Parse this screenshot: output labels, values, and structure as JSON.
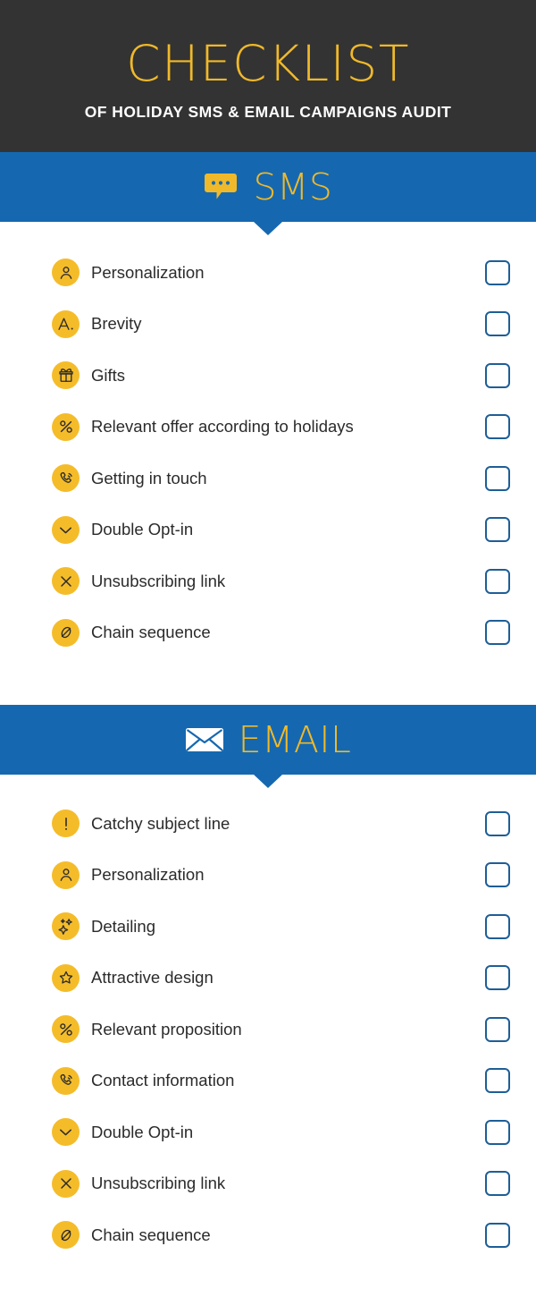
{
  "header": {
    "title": "CHECKLIST",
    "subtitle": "OF HOLIDAY SMS & EMAIL CAMPAIGNS AUDIT"
  },
  "colors": {
    "header_bg": "#333333",
    "banner_bg": "#1568B0",
    "gold": "#F0B92A",
    "bullet_gold": "#F5BC2A",
    "text_dark": "#2B2B2B",
    "checkbox_border": "#1E5E96",
    "page_bg": "#FFFFFF"
  },
  "sections": [
    {
      "id": "sms",
      "label": "SMS",
      "icon": "speech-bubble-icon",
      "items": [
        {
          "label": "Personalization",
          "icon": "person-icon",
          "checked": false
        },
        {
          "label": "Brevity",
          "icon": "letter-a-icon",
          "checked": false
        },
        {
          "label": "Gifts",
          "icon": "gift-box-icon",
          "checked": false
        },
        {
          "label": "Relevant offer according to holidays",
          "icon": "percent-icon",
          "checked": false
        },
        {
          "label": "Getting in touch",
          "icon": "phone-call-icon",
          "checked": false
        },
        {
          "label": "Double Opt-in",
          "icon": "chevron-down-icon",
          "checked": false
        },
        {
          "label": "Unsubscribing link",
          "icon": "close-x-icon",
          "checked": false
        },
        {
          "label": "Chain sequence",
          "icon": "slashed-circle-icon",
          "checked": false
        }
      ]
    },
    {
      "id": "email",
      "label": "EMAIL",
      "icon": "envelope-icon",
      "items": [
        {
          "label": "Catchy subject line",
          "icon": "exclamation-icon",
          "checked": false
        },
        {
          "label": "Personalization",
          "icon": "person-icon",
          "checked": false
        },
        {
          "label": "Detailing",
          "icon": "sparkles-icon",
          "checked": false
        },
        {
          "label": "Attractive design",
          "icon": "star-icon",
          "checked": false
        },
        {
          "label": "Relevant proposition",
          "icon": "percent-icon",
          "checked": false
        },
        {
          "label": "Contact information",
          "icon": "phone-call-icon",
          "checked": false
        },
        {
          "label": "Double Opt-in",
          "icon": "chevron-down-icon",
          "checked": false
        },
        {
          "label": "Unsubscribing link",
          "icon": "close-x-icon",
          "checked": false
        },
        {
          "label": "Chain sequence",
          "icon": "slashed-circle-icon",
          "checked": false
        }
      ]
    }
  ]
}
